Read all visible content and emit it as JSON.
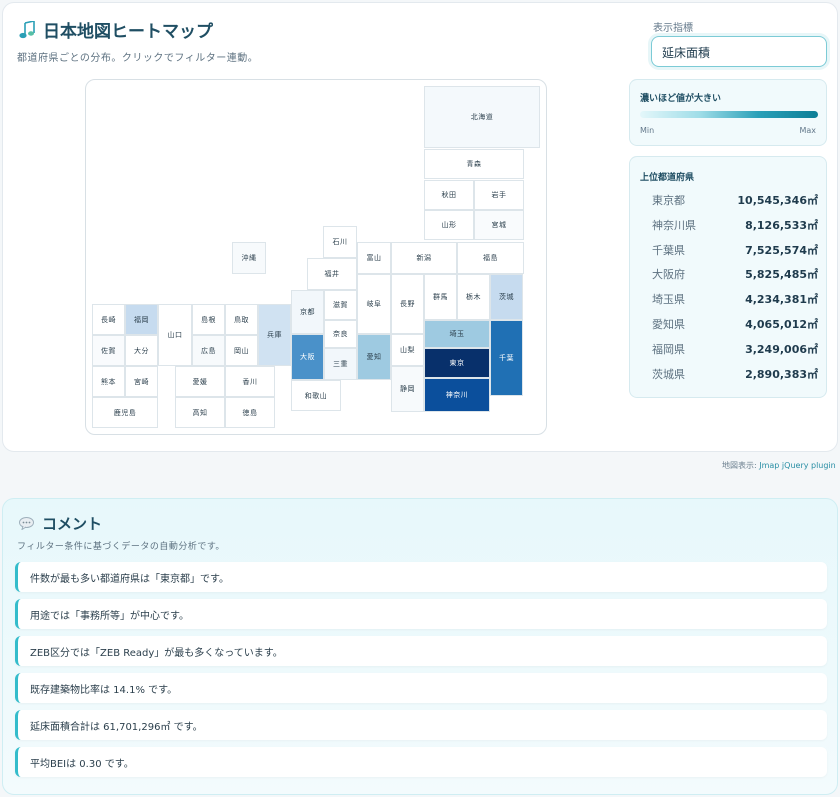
{
  "header": {
    "title": "日本地図ヒートマップ",
    "subtitle": "都道府県ごとの分布。クリックでフィルター連動。"
  },
  "metric": {
    "label": "表示指標",
    "selected": "延床面積"
  },
  "legend": {
    "title": "濃いほど値が大きい",
    "min": "Min",
    "max": "Max"
  },
  "top": {
    "title": "上位都道府県",
    "items": [
      {
        "name": "東京都",
        "value": "10,545,346㎡"
      },
      {
        "name": "神奈川県",
        "value": "8,126,533㎡"
      },
      {
        "name": "千葉県",
        "value": "7,525,574㎡"
      },
      {
        "name": "大阪府",
        "value": "5,825,485㎡"
      },
      {
        "name": "埼玉県",
        "value": "4,234,381㎡"
      },
      {
        "name": "愛知県",
        "value": "4,065,012㎡"
      },
      {
        "name": "福岡県",
        "value": "3,249,006㎡"
      },
      {
        "name": "茨城県",
        "value": "2,890,383㎡"
      }
    ]
  },
  "map": {
    "prefectures": [
      {
        "key": "hokkaido",
        "label": "北海道",
        "color": "#f4f9fc"
      },
      {
        "key": "aomori",
        "label": "青森",
        "color": "#ffffff"
      },
      {
        "key": "akita",
        "label": "秋田",
        "color": "#ffffff"
      },
      {
        "key": "iwate",
        "label": "岩手",
        "color": "#ffffff"
      },
      {
        "key": "yamagata",
        "label": "山形",
        "color": "#ffffff"
      },
      {
        "key": "miyagi",
        "label": "宮城",
        "color": "#f9fbfd"
      },
      {
        "key": "ishikawa",
        "label": "石川",
        "color": "#ffffff"
      },
      {
        "key": "toyama",
        "label": "富山",
        "color": "#ffffff"
      },
      {
        "key": "niigata",
        "label": "新潟",
        "color": "#ffffff"
      },
      {
        "key": "fukushima",
        "label": "福島",
        "color": "#ffffff"
      },
      {
        "key": "okinawa",
        "label": "沖縄",
        "color": "#f7fafc"
      },
      {
        "key": "fukui",
        "label": "福井",
        "color": "#ffffff"
      },
      {
        "key": "nagasaki",
        "label": "長崎",
        "color": "#ffffff"
      },
      {
        "key": "fukuoka",
        "label": "福岡",
        "color": "#c6dbef"
      },
      {
        "key": "yamaguchi",
        "label": "山口",
        "color": "#ffffff"
      },
      {
        "key": "shimane",
        "label": "島根",
        "color": "#ffffff"
      },
      {
        "key": "tottori",
        "label": "鳥取",
        "color": "#ffffff"
      },
      {
        "key": "hyogo",
        "label": "兵庫",
        "color": "#d0e2f2"
      },
      {
        "key": "kyoto",
        "label": "京都",
        "color": "#f2f7fb"
      },
      {
        "key": "shiga",
        "label": "滋賀",
        "color": "#ffffff"
      },
      {
        "key": "gifu",
        "label": "岐阜",
        "color": "#ffffff"
      },
      {
        "key": "nagano",
        "label": "長野",
        "color": "#ffffff"
      },
      {
        "key": "gunma",
        "label": "群馬",
        "color": "#ffffff"
      },
      {
        "key": "tochigi",
        "label": "栃木",
        "color": "#ffffff"
      },
      {
        "key": "ibaraki",
        "label": "茨城",
        "color": "#c6dbef"
      },
      {
        "key": "saga",
        "label": "佐賀",
        "color": "#f9fbfd"
      },
      {
        "key": "oita",
        "label": "大分",
        "color": "#ffffff"
      },
      {
        "key": "hiroshima",
        "label": "広島",
        "color": "#f7fafc"
      },
      {
        "key": "okayama",
        "label": "岡山",
        "color": "#ffffff"
      },
      {
        "key": "osaka",
        "label": "大阪",
        "color": "#4a91c9"
      },
      {
        "key": "nara",
        "label": "奈良",
        "color": "#ffffff"
      },
      {
        "key": "aichi",
        "label": "愛知",
        "color": "#9ecae1"
      },
      {
        "key": "saitama",
        "label": "埼玉",
        "color": "#9ecae1"
      },
      {
        "key": "chiba",
        "label": "千葉",
        "color": "#2070b4"
      },
      {
        "key": "kumamoto",
        "label": "熊本",
        "color": "#ffffff"
      },
      {
        "key": "miyazaki",
        "label": "宮崎",
        "color": "#ffffff"
      },
      {
        "key": "ehime",
        "label": "愛媛",
        "color": "#ffffff"
      },
      {
        "key": "kagawa",
        "label": "香川",
        "color": "#ffffff"
      },
      {
        "key": "mie",
        "label": "三重",
        "color": "#f2f7fb"
      },
      {
        "key": "yamanashi",
        "label": "山梨",
        "color": "#ffffff"
      },
      {
        "key": "tokyo",
        "label": "東京",
        "color": "#08306b"
      },
      {
        "key": "wakayama",
        "label": "和歌山",
        "color": "#ffffff"
      },
      {
        "key": "shizuoka",
        "label": "静岡",
        "color": "#f7fafc"
      },
      {
        "key": "kanagawa",
        "label": "神奈川",
        "color": "#0b4f9c"
      },
      {
        "key": "kagoshima",
        "label": "鹿児島",
        "color": "#ffffff"
      },
      {
        "key": "kochi",
        "label": "高知",
        "color": "#ffffff"
      },
      {
        "key": "tokushima",
        "label": "徳島",
        "color": "#ffffff"
      }
    ]
  },
  "credit": {
    "prefix": "地図表示: ",
    "link": "Jmap jQuery plugin"
  },
  "comments": {
    "title": "コメント",
    "subtitle": "フィルター条件に基づくデータの自動分析です。",
    "items": [
      "件数が最も多い都道府県は「東京都」です。",
      "用途では「事務所等」が中心です。",
      "ZEB区分では「ZEB Ready」が最も多くなっています。",
      "既存建築物比率は 14.1% です。",
      "延床面積合計は 61,701,296㎡ です。",
      "平均BEIは 0.30 です。"
    ]
  }
}
